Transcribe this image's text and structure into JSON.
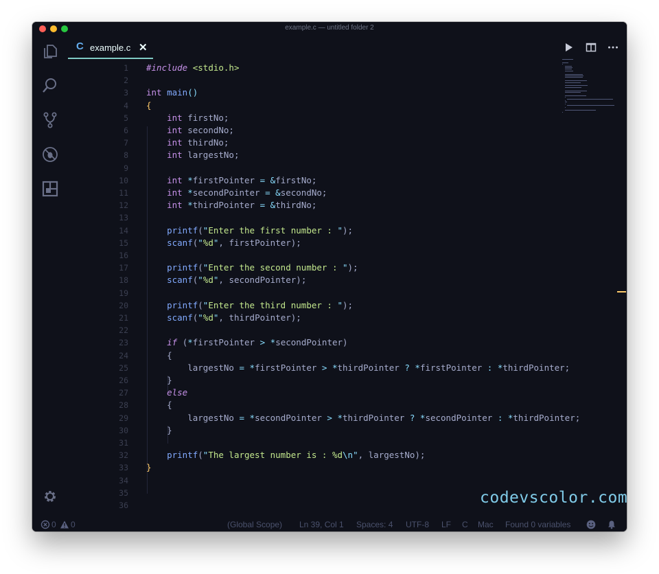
{
  "window": {
    "title": "example.c — untitled folder 2"
  },
  "activity_bar": {
    "icons": [
      "explorer-icon",
      "search-icon",
      "source-control-icon",
      "debug-icon",
      "extensions-icon",
      "settings-gear-icon"
    ]
  },
  "tab": {
    "icon_letter": "C",
    "label": "example.c",
    "close_glyph": "✕"
  },
  "tab_actions": [
    "run-icon",
    "split-editor-icon",
    "more-actions-icon"
  ],
  "code_lines": [
    [
      {
        "t": "#include",
        "c": "kwi"
      },
      {
        "t": " "
      },
      {
        "t": "<stdio.h>",
        "c": "inc"
      }
    ],
    [],
    [
      {
        "t": "int",
        "c": "kw"
      },
      {
        "t": " "
      },
      {
        "t": "main",
        "c": "fn"
      },
      {
        "t": "()",
        "c": "op"
      }
    ],
    [
      {
        "t": "{",
        "c": "brace"
      }
    ],
    [
      {
        "t": "    "
      },
      {
        "t": "int",
        "c": "kw"
      },
      {
        "t": " firstNo;"
      }
    ],
    [
      {
        "t": "    "
      },
      {
        "t": "int",
        "c": "kw"
      },
      {
        "t": " secondNo;"
      }
    ],
    [
      {
        "t": "    "
      },
      {
        "t": "int",
        "c": "kw"
      },
      {
        "t": " thirdNo;"
      }
    ],
    [
      {
        "t": "    "
      },
      {
        "t": "int",
        "c": "kw"
      },
      {
        "t": " largestNo;"
      }
    ],
    [],
    [
      {
        "t": "    "
      },
      {
        "t": "int",
        "c": "kw"
      },
      {
        "t": " "
      },
      {
        "t": "*",
        "c": "op"
      },
      {
        "t": "firstPointer "
      },
      {
        "t": "=",
        "c": "op"
      },
      {
        "t": " "
      },
      {
        "t": "&",
        "c": "op"
      },
      {
        "t": "firstNo;"
      }
    ],
    [
      {
        "t": "    "
      },
      {
        "t": "int",
        "c": "kw"
      },
      {
        "t": " "
      },
      {
        "t": "*",
        "c": "op"
      },
      {
        "t": "secondPointer "
      },
      {
        "t": "=",
        "c": "op"
      },
      {
        "t": " "
      },
      {
        "t": "&",
        "c": "op"
      },
      {
        "t": "secondNo;"
      }
    ],
    [
      {
        "t": "    "
      },
      {
        "t": "int",
        "c": "kw"
      },
      {
        "t": " "
      },
      {
        "t": "*",
        "c": "op"
      },
      {
        "t": "thirdPointer "
      },
      {
        "t": "=",
        "c": "op"
      },
      {
        "t": " "
      },
      {
        "t": "&",
        "c": "op"
      },
      {
        "t": "thirdNo;"
      }
    ],
    [],
    [
      {
        "t": "    "
      },
      {
        "t": "printf",
        "c": "fn"
      },
      {
        "t": "("
      },
      {
        "t": "\"",
        "c": "op"
      },
      {
        "t": "Enter the first number : ",
        "c": "str"
      },
      {
        "t": "\"",
        "c": "op"
      },
      {
        "t": ");"
      }
    ],
    [
      {
        "t": "    "
      },
      {
        "t": "scanf",
        "c": "fn"
      },
      {
        "t": "("
      },
      {
        "t": "\"",
        "c": "op"
      },
      {
        "t": "%d",
        "c": "str"
      },
      {
        "t": "\"",
        "c": "op"
      },
      {
        "t": ", firstPointer);"
      }
    ],
    [],
    [
      {
        "t": "    "
      },
      {
        "t": "printf",
        "c": "fn"
      },
      {
        "t": "("
      },
      {
        "t": "\"",
        "c": "op"
      },
      {
        "t": "Enter the second number : ",
        "c": "str"
      },
      {
        "t": "\"",
        "c": "op"
      },
      {
        "t": ");"
      }
    ],
    [
      {
        "t": "    "
      },
      {
        "t": "scanf",
        "c": "fn"
      },
      {
        "t": "("
      },
      {
        "t": "\"",
        "c": "op"
      },
      {
        "t": "%d",
        "c": "str"
      },
      {
        "t": "\"",
        "c": "op"
      },
      {
        "t": ", secondPointer);"
      }
    ],
    [],
    [
      {
        "t": "    "
      },
      {
        "t": "printf",
        "c": "fn"
      },
      {
        "t": "("
      },
      {
        "t": "\"",
        "c": "op"
      },
      {
        "t": "Enter the third number : ",
        "c": "str"
      },
      {
        "t": "\"",
        "c": "op"
      },
      {
        "t": ");"
      }
    ],
    [
      {
        "t": "    "
      },
      {
        "t": "scanf",
        "c": "fn"
      },
      {
        "t": "("
      },
      {
        "t": "\"",
        "c": "op"
      },
      {
        "t": "%d",
        "c": "str"
      },
      {
        "t": "\"",
        "c": "op"
      },
      {
        "t": ", thirdPointer);"
      }
    ],
    [],
    [
      {
        "t": "    "
      },
      {
        "t": "if",
        "c": "kwi"
      },
      {
        "t": " ("
      },
      {
        "t": "*",
        "c": "op"
      },
      {
        "t": "firstPointer "
      },
      {
        "t": ">",
        "c": "op"
      },
      {
        "t": " "
      },
      {
        "t": "*",
        "c": "op"
      },
      {
        "t": "secondPointer)"
      }
    ],
    [
      {
        "t": "    "
      },
      {
        "t": "{"
      }
    ],
    [
      {
        "t": "        largestNo "
      },
      {
        "t": "=",
        "c": "op"
      },
      {
        "t": " "
      },
      {
        "t": "*",
        "c": "op"
      },
      {
        "t": "firstPointer "
      },
      {
        "t": ">",
        "c": "op"
      },
      {
        "t": " "
      },
      {
        "t": "*",
        "c": "op"
      },
      {
        "t": "thirdPointer "
      },
      {
        "t": "?",
        "c": "op"
      },
      {
        "t": " "
      },
      {
        "t": "*",
        "c": "op"
      },
      {
        "t": "firstPointer "
      },
      {
        "t": ":",
        "c": "op"
      },
      {
        "t": " "
      },
      {
        "t": "*",
        "c": "op"
      },
      {
        "t": "thirdPointer;"
      }
    ],
    [
      {
        "t": "    "
      },
      {
        "t": "}"
      }
    ],
    [
      {
        "t": "    "
      },
      {
        "t": "else",
        "c": "kwi"
      }
    ],
    [
      {
        "t": "    "
      },
      {
        "t": "{"
      }
    ],
    [
      {
        "t": "        largestNo "
      },
      {
        "t": "=",
        "c": "op"
      },
      {
        "t": " "
      },
      {
        "t": "*",
        "c": "op"
      },
      {
        "t": "secondPointer "
      },
      {
        "t": ">",
        "c": "op"
      },
      {
        "t": " "
      },
      {
        "t": "*",
        "c": "op"
      },
      {
        "t": "thirdPointer "
      },
      {
        "t": "?",
        "c": "op"
      },
      {
        "t": " "
      },
      {
        "t": "*",
        "c": "op"
      },
      {
        "t": "secondPointer "
      },
      {
        "t": ":",
        "c": "op"
      },
      {
        "t": " "
      },
      {
        "t": "*",
        "c": "op"
      },
      {
        "t": "thirdPointer;"
      }
    ],
    [
      {
        "t": "    "
      },
      {
        "t": "}"
      }
    ],
    [],
    [
      {
        "t": "    "
      },
      {
        "t": "printf",
        "c": "fn"
      },
      {
        "t": "("
      },
      {
        "t": "\"",
        "c": "op"
      },
      {
        "t": "The largest number is : %d",
        "c": "str"
      },
      {
        "t": "\\n",
        "c": "op"
      },
      {
        "t": "\"",
        "c": "op"
      },
      {
        "t": ", largestNo);"
      }
    ],
    [
      {
        "t": "}",
        "c": "brace"
      }
    ],
    [],
    [],
    []
  ],
  "watermark": "codevscolor.com",
  "statusbar": {
    "errors": "0",
    "warnings": "0",
    "scope": "(Global Scope)",
    "cursor": "Ln 39, Col 1",
    "spaces": "Spaces: 4",
    "encoding": "UTF-8",
    "eol": "LF",
    "language": "C",
    "platform": "Mac",
    "variables": "Found 0 variables"
  },
  "colors": {
    "background": "#0f111a",
    "accent": "#80cbc4",
    "keyword": "#c792ea",
    "function": "#82aaff",
    "string": "#c3e88d",
    "operator": "#89ddff",
    "brace": "#ffcb6b"
  }
}
